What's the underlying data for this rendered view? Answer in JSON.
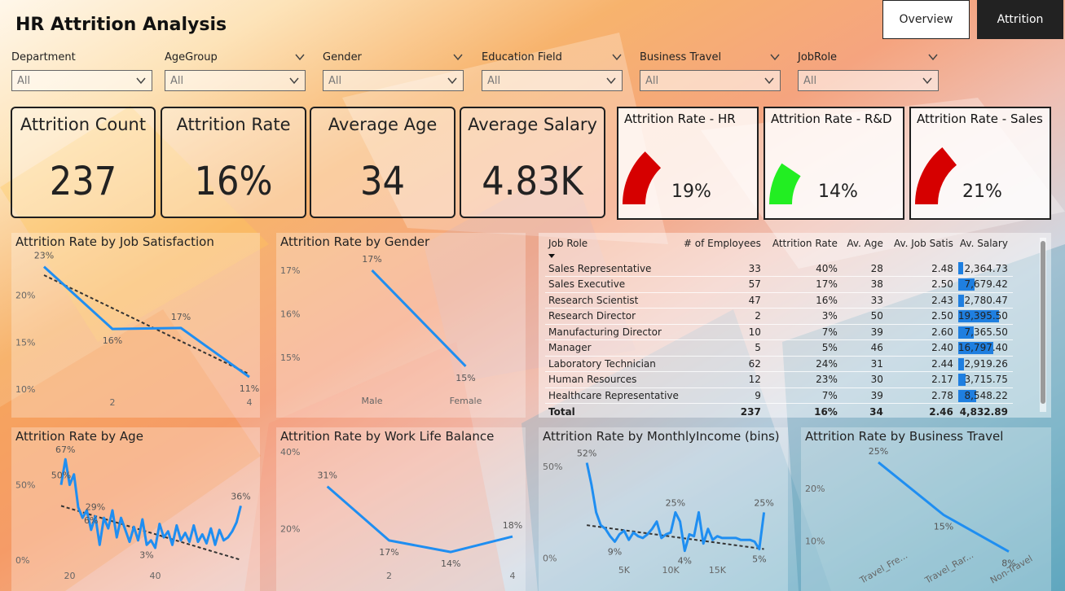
{
  "title": "HR Attrition Analysis",
  "nav": {
    "overview": "Overview",
    "attrition": "Attrition"
  },
  "slicers": [
    {
      "label": "Department",
      "value": "All"
    },
    {
      "label": "AgeGroup",
      "value": "All"
    },
    {
      "label": "Gender",
      "value": "All"
    },
    {
      "label": "Education Field",
      "value": "All"
    },
    {
      "label": "Business Travel",
      "value": "All"
    },
    {
      "label": "JobRole",
      "value": "All"
    }
  ],
  "cards": [
    {
      "label": "Attrition Count",
      "value": "237"
    },
    {
      "label": "Attrition Rate",
      "value": "16%"
    },
    {
      "label": "Average Age",
      "value": "34"
    },
    {
      "label": "Average Salary",
      "value": "4.83K"
    }
  ],
  "gauges": [
    {
      "label": "Attrition Rate - HR",
      "value": "19%",
      "fraction": 0.19,
      "color": "#d60000"
    },
    {
      "label": "Attrition Rate - R&D",
      "value": "14%",
      "fraction": 0.14,
      "color": "#22ee22"
    },
    {
      "label": "Attrition Rate - Sales",
      "value": "21%",
      "fraction": 0.21,
      "color": "#d60000"
    }
  ],
  "colors": {
    "line": "#1f8ef1",
    "trend": "#333333",
    "bar": "#1f7fe0"
  },
  "chart_data": [
    {
      "id": "job_satisfaction",
      "type": "line",
      "title": "Attrition Rate by Job Satisfaction",
      "x": [
        1,
        2,
        3,
        4
      ],
      "y": [
        23,
        16.4,
        16.5,
        11.3
      ],
      "labels": [
        "23%",
        "16%",
        "17%",
        "11%"
      ],
      "xticks": [
        2,
        4
      ],
      "yticks": [
        "10%",
        "15%",
        "20%"
      ],
      "ytickvals": [
        10,
        15,
        20
      ],
      "xlim": [
        1,
        4
      ],
      "ylim": [
        9.5,
        24
      ],
      "trend": [
        22.1,
        11.6
      ]
    },
    {
      "id": "gender",
      "type": "line",
      "title": "Attrition Rate by Gender",
      "categories": [
        "Male",
        "Female"
      ],
      "y": [
        17,
        14.8
      ],
      "labels": [
        "17%",
        "15%"
      ],
      "yticks": [
        "15%",
        "16%",
        "17%"
      ],
      "ytickvals": [
        15,
        16,
        17
      ],
      "ylim": [
        14.5,
        17.3
      ]
    },
    {
      "id": "age",
      "type": "line",
      "title": "Attrition Rate by Age",
      "x": [
        18,
        19,
        20,
        21,
        22,
        23,
        24,
        25,
        26,
        27,
        28,
        29,
        30,
        31,
        32,
        33,
        34,
        35,
        36,
        37,
        38,
        39,
        40,
        41,
        42,
        43,
        44,
        45,
        46,
        47,
        48,
        49,
        50,
        51,
        52,
        53,
        54,
        55,
        56,
        57,
        58,
        59,
        60
      ],
      "y": [
        50,
        67,
        50,
        57,
        35,
        28,
        33,
        20,
        29,
        10,
        28,
        21,
        33,
        15,
        28,
        20,
        12,
        22,
        13,
        27,
        10,
        13,
        8,
        24,
        15,
        19,
        10,
        23,
        13,
        18,
        12,
        23,
        12,
        17,
        11,
        21,
        10,
        20,
        13,
        15,
        19,
        25,
        36
      ],
      "annotations": [
        {
          "x": 19,
          "text": "67%"
        },
        {
          "x": 18,
          "text": "50%"
        },
        {
          "x": 26,
          "text": "29%"
        },
        {
          "x": 25,
          "text": "6%"
        },
        {
          "x": 38,
          "text": "3%"
        },
        {
          "x": 60,
          "text": "36%"
        }
      ],
      "xticks": [
        20,
        40
      ],
      "yticks": [
        "0%",
        "50%"
      ],
      "ytickvals": [
        0,
        50
      ],
      "xlim": [
        14,
        62
      ],
      "ylim": [
        -5,
        72
      ],
      "trend": [
        36,
        0
      ]
    },
    {
      "id": "work_life_balance",
      "type": "line",
      "title": "Attrition Rate by Work Life Balance",
      "x": [
        1,
        2,
        3,
        4
      ],
      "y": [
        31,
        17,
        14,
        18
      ],
      "labels": [
        "31%",
        "17%",
        "14%",
        "18%"
      ],
      "xticks": [
        2,
        4
      ],
      "yticks": [
        "20%",
        "40%"
      ],
      "ytickvals": [
        20,
        40
      ],
      "xlim": [
        0.7,
        4
      ],
      "ylim": [
        10,
        40
      ]
    },
    {
      "id": "monthly_income",
      "type": "line",
      "title": "Attrition Rate by MonthlyIncome (bins)",
      "x": [
        1000,
        1500,
        2000,
        2500,
        3000,
        3500,
        4000,
        4500,
        5000,
        5500,
        6000,
        6500,
        7000,
        7500,
        8000,
        8500,
        9000,
        9500,
        10000,
        10500,
        11000,
        11500,
        12000,
        12500,
        13000,
        13500,
        14000,
        14500,
        15000,
        15500,
        16000,
        16500,
        17000,
        17500,
        18000,
        18500,
        19000,
        19500,
        20000
      ],
      "y": [
        52,
        40,
        25,
        18,
        16,
        12,
        9,
        13,
        15,
        10,
        14,
        12,
        11,
        13,
        16,
        20,
        11,
        13,
        14,
        25,
        20,
        4,
        13,
        12,
        25,
        8,
        16,
        10,
        12,
        11,
        11,
        11,
        11,
        10,
        10,
        10,
        9,
        5,
        25
      ],
      "annotations": [
        {
          "x": 1000,
          "text": "52%"
        },
        {
          "x": 4000,
          "text": "9%"
        },
        {
          "x": 10500,
          "text": "25%"
        },
        {
          "x": 11500,
          "text": "4%"
        },
        {
          "x": 19500,
          "text": "5%"
        },
        {
          "x": 20000,
          "text": "25%"
        }
      ],
      "xticks": [
        "5K",
        "10K",
        "15K"
      ],
      "xtickvals": [
        5000,
        10000,
        15000
      ],
      "yticks": [
        "0%",
        "50%"
      ],
      "ytickvals": [
        0,
        50
      ],
      "xlim": [
        -500,
        21000
      ],
      "ylim": [
        -5,
        58
      ],
      "trend": [
        18,
        5
      ]
    },
    {
      "id": "business_travel",
      "type": "line",
      "title": "Attrition Rate by Business Travel",
      "categories": [
        "Travel_Fre...",
        "Travel_Rar...",
        "Non-Travel"
      ],
      "y": [
        25,
        15,
        8
      ],
      "labels": [
        "25%",
        "15%",
        "8%"
      ],
      "yticks": [
        "10%",
        "20%"
      ],
      "ytickvals": [
        10,
        20
      ],
      "ylim": [
        5,
        27
      ]
    }
  ],
  "table": {
    "columns": [
      "Job Role",
      "# of Employees",
      "Attrition Rate",
      "Av. Age",
      "Av. Job Satis",
      "Av. Salary"
    ],
    "rows": [
      [
        "Sales Representative",
        "33",
        "40%",
        "28",
        "2.48",
        "2,364.73",
        2364.73
      ],
      [
        "Sales Executive",
        "57",
        "17%",
        "38",
        "2.50",
        "7,679.42",
        7679.42
      ],
      [
        "Research Scientist",
        "47",
        "16%",
        "33",
        "2.43",
        "2,780.47",
        2780.47
      ],
      [
        "Research Director",
        "2",
        "3%",
        "50",
        "2.50",
        "19,395.50",
        19395.5
      ],
      [
        "Manufacturing Director",
        "10",
        "7%",
        "39",
        "2.60",
        "7,365.50",
        7365.5
      ],
      [
        "Manager",
        "5",
        "5%",
        "46",
        "2.40",
        "16,797.40",
        16797.4
      ],
      [
        "Laboratory Technician",
        "62",
        "24%",
        "31",
        "2.44",
        "2,919.26",
        2919.26
      ],
      [
        "Human Resources",
        "12",
        "23%",
        "30",
        "2.17",
        "3,715.75",
        3715.75
      ],
      [
        "Healthcare Representative",
        "9",
        "7%",
        "39",
        "2.78",
        "8,548.22",
        8548.22
      ]
    ],
    "total": [
      "Total",
      "237",
      "16%",
      "34",
      "2.46",
      "4,832.89"
    ],
    "salary_max": 19395.5
  }
}
